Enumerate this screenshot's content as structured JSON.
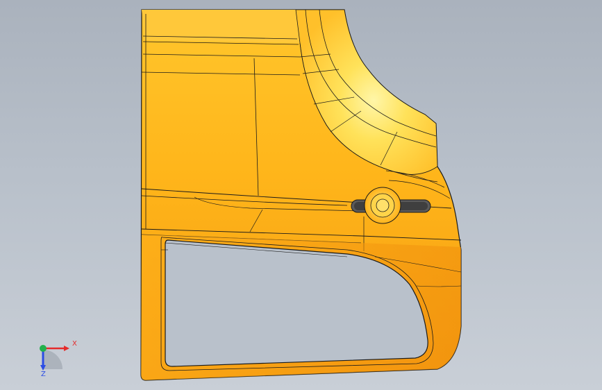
{
  "viewport": {
    "background": [
      "#aab2bd",
      "#c9cfd7"
    ]
  },
  "model": {
    "part_color_light": "#ffd23c",
    "part_color_mid": "#ffb319",
    "part_color_dark": "#f29a10",
    "edge_color": "#1a1a1a",
    "handle_color": "#555555"
  },
  "triad": {
    "x_label": "X",
    "z_label": "Z",
    "y_icon": "y-axis-dot",
    "x_color": "#e52b2b",
    "y_color": "#22b14c",
    "z_color": "#2b4de5"
  }
}
